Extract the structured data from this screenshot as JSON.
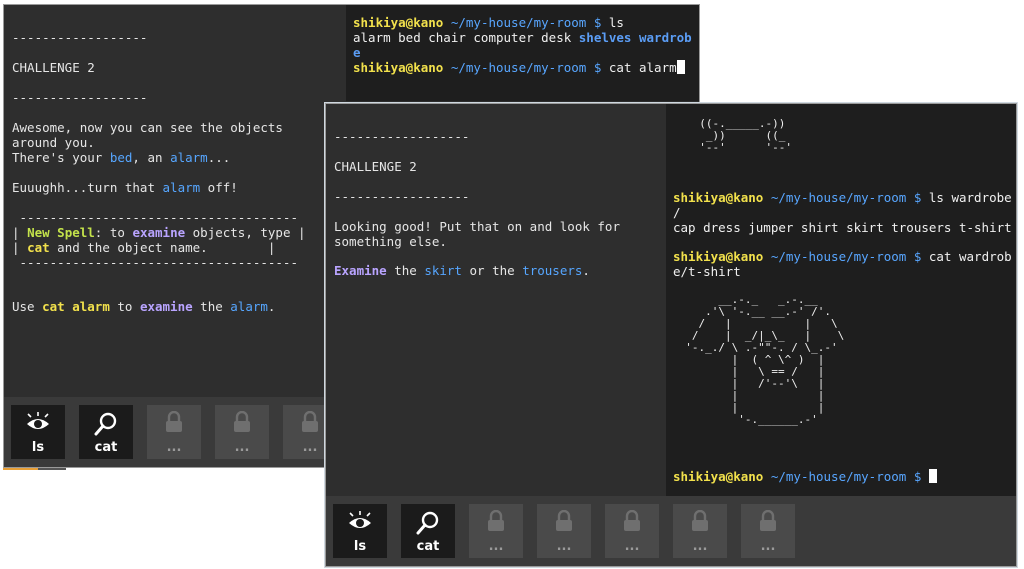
{
  "window1": {
    "story": {
      "divider": "------------------",
      "challenge": "CHALLENGE 2",
      "line1": "Awesome, now you can see the objects",
      "line2": "around you.",
      "line3_pre": "There's your ",
      "line3_bed": "bed",
      "line3_mid": ", an ",
      "line3_alarm": "alarm",
      "line3_post": "...",
      "line4_pre": "Euuughh...turn that ",
      "line4_alarm": "alarm",
      "line4_post": " off!",
      "box_top": " -------------------------------------",
      "box_bar": "| ",
      "box_spell": "New Spell",
      "box_l1_mid": ": to ",
      "box_examine": "examine",
      "box_l1_post": " objects, type |",
      "box_cat": "cat",
      "box_l2_post": " and the object name.        |",
      "box_bottom": " -------------------------------------",
      "use_pre": "Use ",
      "use_cmd": "cat alarm",
      "use_mid": " to ",
      "use_examine": "examine",
      "use_mid2": " the ",
      "use_alarm": "alarm",
      "use_post": "."
    },
    "terminal": {
      "user": "shikiya@kano",
      "path": " ~/my-house/my-room $ ",
      "cmd1": "ls",
      "out_plain": "alarm bed chair computer desk ",
      "out_dirs": "shelves wardrob",
      "out_dirs_wrap": "e",
      "cmd2": "cat alarm"
    },
    "spells": [
      {
        "label": "ls",
        "icon": "eye-icon"
      },
      {
        "label": "cat",
        "icon": "magnifier-icon"
      },
      {
        "label": "...",
        "icon": "lock-icon"
      },
      {
        "label": "...",
        "icon": "lock-icon"
      },
      {
        "label": "...",
        "icon": "lock-icon"
      }
    ]
  },
  "window2": {
    "story": {
      "divider": "------------------",
      "challenge": "CHALLENGE 2",
      "line1": "Looking good! Put that on and look for",
      "line2": "something else.",
      "l3_examine": "Examine",
      "l3_the": " the ",
      "l3_skirt": "skirt",
      "l3_or": " or the ",
      "l3_trousers": "trousers",
      "l3_post": "."
    },
    "terminal": {
      "art_top": "  ((-._____.-))\n   _))      ((_\n  '--'      '--'",
      "user": "shikiya@kano",
      "path": " ~/my-house/my-room $ ",
      "cmd1": "ls wardrobe",
      "cmd1_wrap": "/",
      "out1": "cap dress jumper shirt skirt trousers t-shirt",
      "cmd2": "cat wardrob",
      "cmd2_wrap": "e/t-shirt",
      "tshirt": "       __.-._   _.-.__\n     .'\\ '-.__ __.-' /'.\n    /   |           |   \\\n   /    |  _/|_\\_   |    \\\n  '-._./ \\ .-\"\"-. / \\_.-'\n         |  ( ^ \\^ )  |\n         |   \\ == /   |\n         |   /'--'\\   |\n         |            |\n         |            |\n          '-.______.-'"
    },
    "spells": [
      {
        "label": "ls",
        "icon": "eye-icon"
      },
      {
        "label": "cat",
        "icon": "magnifier-icon"
      },
      {
        "label": "...",
        "icon": "lock-icon"
      },
      {
        "label": "...",
        "icon": "lock-icon"
      },
      {
        "label": "...",
        "icon": "lock-icon"
      },
      {
        "label": "...",
        "icon": "lock-icon"
      },
      {
        "label": "...",
        "icon": "lock-icon"
      }
    ]
  }
}
